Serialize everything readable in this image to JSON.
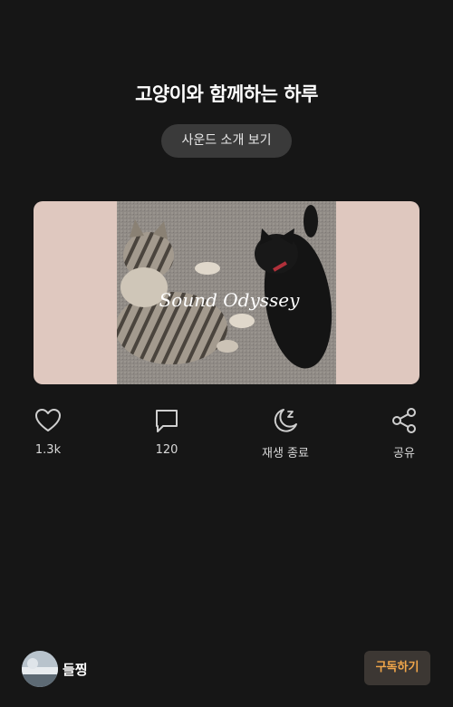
{
  "page": {
    "title": "고양이와 함께하는 하루",
    "intro_button": "사운드 소개 보기"
  },
  "cover": {
    "watermark": "Sound Odyssey"
  },
  "actions": [
    {
      "icon": "heart-icon",
      "label": "1.3k"
    },
    {
      "icon": "comment-icon",
      "label": "120"
    },
    {
      "icon": "sleep-timer-icon",
      "label": "재생 종료"
    },
    {
      "icon": "share-icon",
      "label": "공유"
    }
  ],
  "footer": {
    "username": "들찡",
    "subscribe_button": "구독하기"
  },
  "colors": {
    "background": "#161616",
    "accent": "#f0a64a",
    "card_background": "#dfc8bf"
  }
}
